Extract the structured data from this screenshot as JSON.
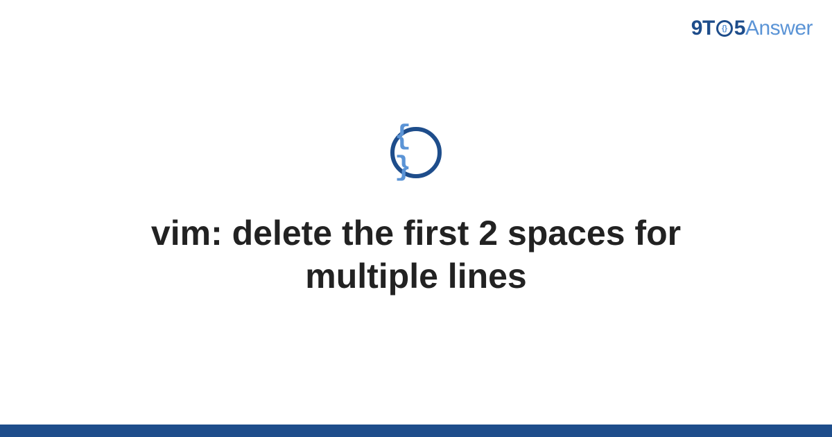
{
  "logo": {
    "part_nine": "9",
    "part_t": "T",
    "part_o_inner": "{}",
    "part_five": "5",
    "part_answer": "Answer"
  },
  "category": {
    "icon_braces": "{ }"
  },
  "title": "vim: delete the first 2 spaces for multiple lines",
  "colors": {
    "brand_dark": "#1e4d8b",
    "brand_light": "#5b94d6"
  }
}
